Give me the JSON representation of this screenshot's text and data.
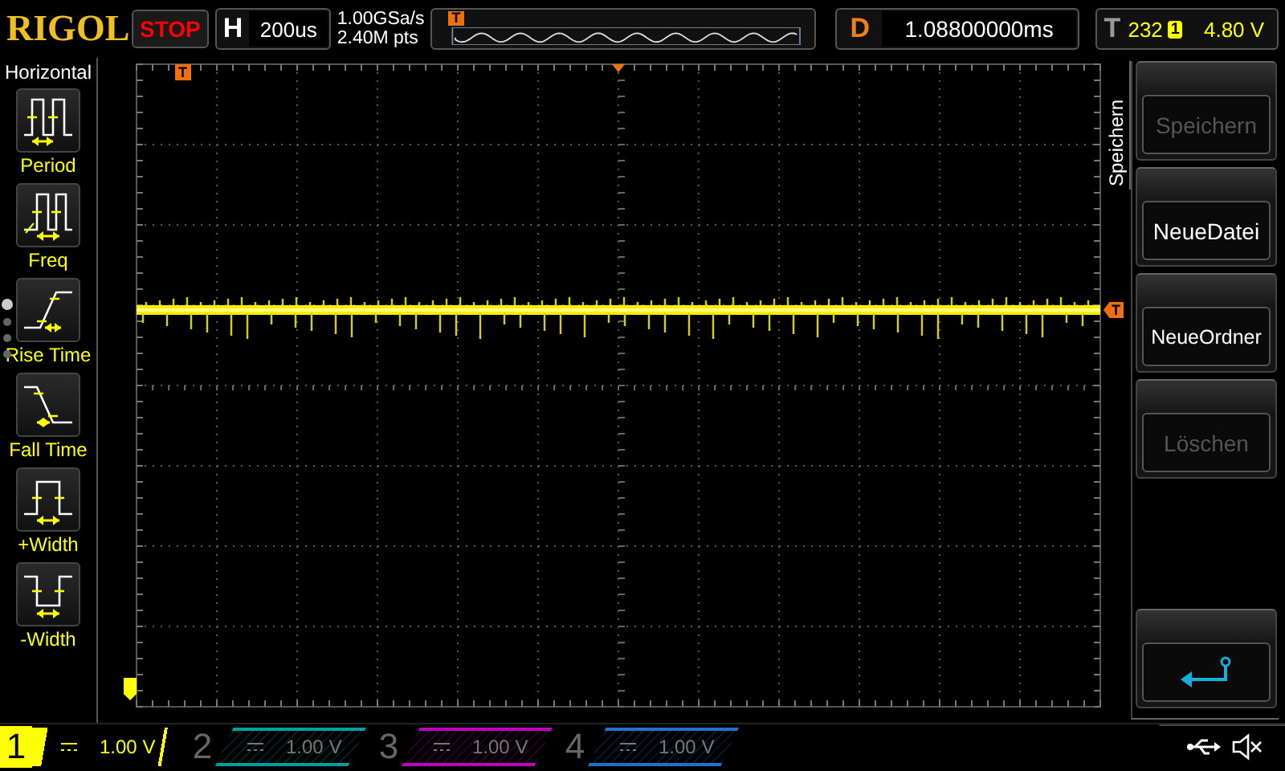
{
  "brand": "RIGOL",
  "run_state": "STOP",
  "horizontal": {
    "label": "H",
    "timebase": "200us"
  },
  "acquisition": {
    "sample_rate": "1.00GSa/s",
    "memory_depth": "2.40M pts"
  },
  "delay": {
    "label": "D",
    "value": "1.08800000ms"
  },
  "trigger": {
    "label": "T",
    "code": "232",
    "source": "1",
    "level": "4.80 V"
  },
  "markers": {
    "memory_trigger_position": "T",
    "screen_trigger_position": "T",
    "trigger_level": "T"
  },
  "menu": {
    "title": "Horizontal",
    "items": [
      {
        "label": "Period",
        "kind": "period"
      },
      {
        "label": "Freq",
        "kind": "freq"
      },
      {
        "label": "Rise Time",
        "kind": "rise"
      },
      {
        "label": "Fall Time",
        "kind": "fall"
      },
      {
        "label": "+Width",
        "kind": "pwidth"
      },
      {
        "label": "-Width",
        "kind": "nwidth"
      }
    ],
    "pages": [
      {
        "selected": true
      },
      {
        "selected": false
      },
      {
        "selected": false
      },
      {
        "selected": false
      }
    ]
  },
  "softkeys": {
    "title": "Speichern",
    "items": [
      {
        "kind": "text",
        "label": "Speichern",
        "disabled": true
      },
      {
        "kind": "text",
        "label": "NeueDatei",
        "disabled": false
      },
      {
        "kind": "text",
        "label": "NeueOrdner",
        "disabled": false
      },
      {
        "kind": "text",
        "label": "Löschen",
        "disabled": true
      },
      {
        "kind": "gap"
      },
      {
        "kind": "back"
      }
    ]
  },
  "channels": [
    {
      "number": "1",
      "scale": "1.00 V",
      "on": true,
      "color": "#ffff00"
    },
    {
      "number": "2",
      "scale": "1.00 V",
      "on": false,
      "color": "#00a0a0"
    },
    {
      "number": "3",
      "scale": "1.00 V",
      "on": false,
      "color": "#c000c0"
    },
    {
      "number": "4",
      "scale": "1.00 V",
      "on": false,
      "color": "#2070d0"
    }
  ]
}
